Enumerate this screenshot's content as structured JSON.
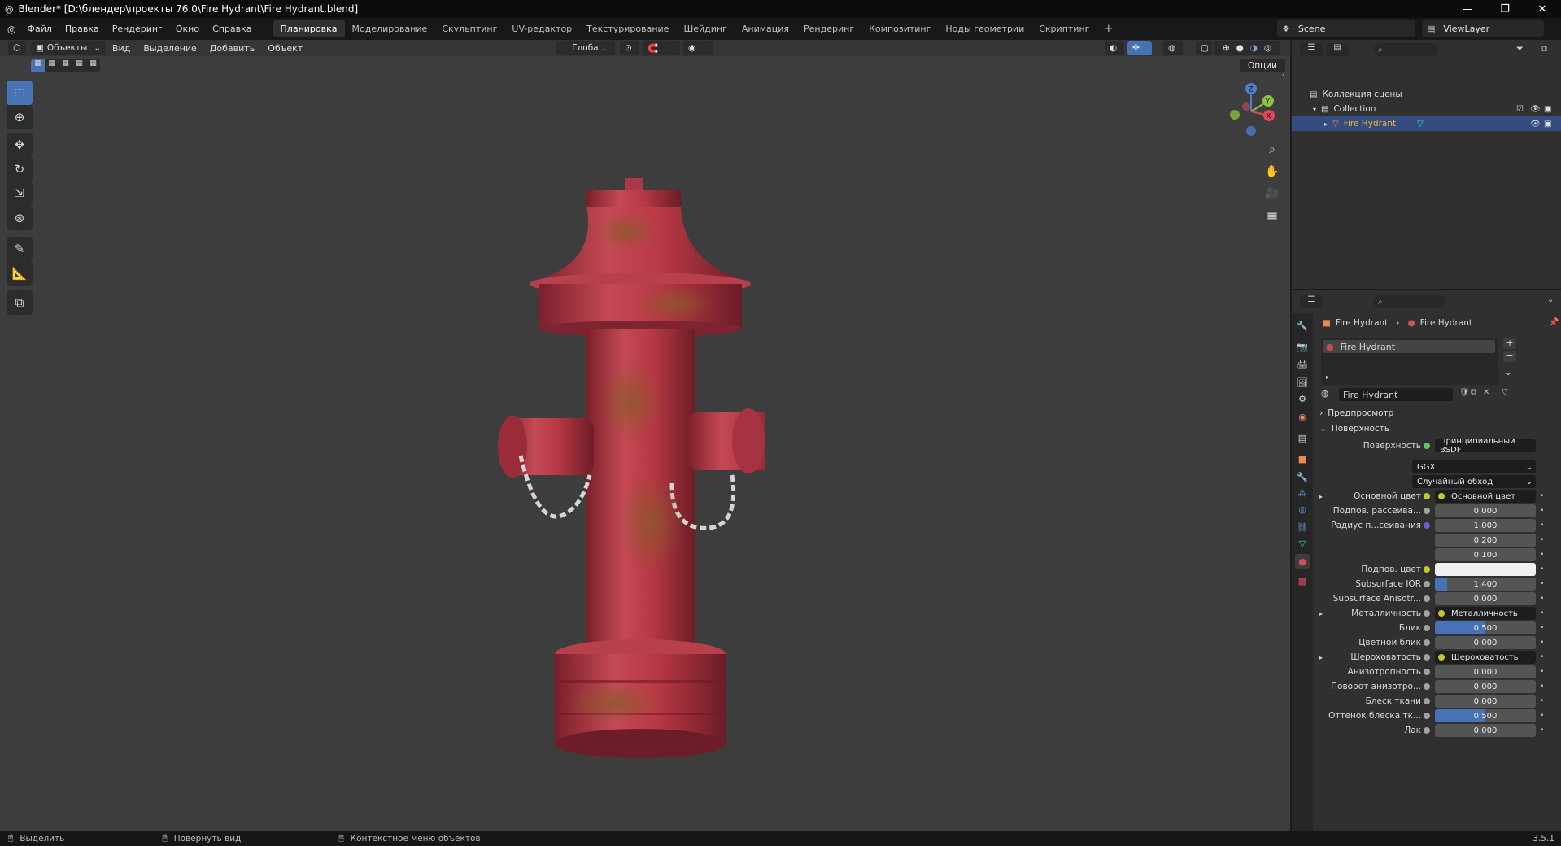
{
  "window": {
    "title": "Blender* [D:\\блендер\\проекты 76.0\\Fire Hydrant\\Fire Hydrant.blend]",
    "minimize": "—",
    "maximize": "❐",
    "close": "✕"
  },
  "menu": {
    "items": [
      "Файл",
      "Правка",
      "Рендеринг",
      "Окно",
      "Справка"
    ],
    "workspaces": [
      "Планировка",
      "Моделирование",
      "Скульптинг",
      "UV-редактор",
      "Текстурирование",
      "Шейдинг",
      "Анимация",
      "Рендеринг",
      "Композитинг",
      "Ноды геометрии",
      "Скриптинг"
    ],
    "add_workspace": "+",
    "scene": "Scene",
    "view_layer": "ViewLayer"
  },
  "viewport": {
    "mode": "Объекты",
    "menu": [
      "Вид",
      "Выделение",
      "Добавить",
      "Объект"
    ],
    "orientation": "Глоба...",
    "options": "Опции",
    "gizmo_axes": {
      "x": "X",
      "y": "Y",
      "z": "Z"
    },
    "colors": {
      "background": "#3d3d3d",
      "hydrant": "#b23a45",
      "active_tool": "#4772b3"
    }
  },
  "outliner": {
    "search_placeholder": "",
    "scene_collection": "Коллекция сцены",
    "collection": "Collection",
    "object": "Fire Hydrant"
  },
  "properties": {
    "breadcrumb_object": "Fire Hydrant",
    "breadcrumb_material": "Fire Hydrant",
    "slot": "Fire Hydrant",
    "material_name": "Fire Hydrant",
    "sections": {
      "preview": "Предпросмотр",
      "surface": "Поверхность"
    },
    "surface_label": "Поверхность",
    "surface_shader": "Принципиальный BSDF",
    "distribution": "GGX",
    "subsurface_method": "Случайный обход",
    "rows": [
      {
        "label": "Основной цвет",
        "value": "Основной цвет",
        "kind": "link",
        "bullet": "y",
        "expand": "▸"
      },
      {
        "label": "Подпов. рассеива...",
        "value": "0.000",
        "kind": "num",
        "bullet": "gr",
        "fill": 0
      },
      {
        "label": "Радиус п...сеивания",
        "value": "1.000",
        "kind": "num",
        "bullet": "b",
        "fill": 0
      },
      {
        "label": "",
        "value": "0.200",
        "kind": "num",
        "bullet": "",
        "fill": 0
      },
      {
        "label": "",
        "value": "0.100",
        "kind": "num",
        "bullet": "",
        "fill": 0
      },
      {
        "label": "Подпов. цвет",
        "value": "",
        "kind": "color",
        "bullet": "y",
        "fill": 0
      },
      {
        "label": "Subsurface IOR",
        "value": "1.400",
        "kind": "num",
        "bullet": "gr",
        "fill": 0.12
      },
      {
        "label": "Subsurface Anisotr...",
        "value": "0.000",
        "kind": "num",
        "bullet": "gr",
        "fill": 0
      },
      {
        "label": "Металличность",
        "value": "Металличность",
        "kind": "link",
        "bullet": "gr",
        "expand": "▸"
      },
      {
        "label": "Блик",
        "value": "0.500",
        "kind": "num",
        "bullet": "gr",
        "fill": 0.5
      },
      {
        "label": "Цветной блик",
        "value": "0.000",
        "kind": "num",
        "bullet": "gr",
        "fill": 0
      },
      {
        "label": "Шероховатость",
        "value": "Шероховатость",
        "kind": "link",
        "bullet": "gr",
        "expand": "▸"
      },
      {
        "label": "Анизотропность",
        "value": "0.000",
        "kind": "num",
        "bullet": "gr",
        "fill": 0
      },
      {
        "label": "Поворот анизотро...",
        "value": "0.000",
        "kind": "num",
        "bullet": "gr",
        "fill": 0
      },
      {
        "label": "Блеск ткани",
        "value": "0.000",
        "kind": "num",
        "bullet": "gr",
        "fill": 0
      },
      {
        "label": "Оттенок блеска тк...",
        "value": "0.500",
        "kind": "num",
        "bullet": "gr",
        "fill": 0.5
      },
      {
        "label": "Лак",
        "value": "0.000",
        "kind": "num",
        "bullet": "gr",
        "fill": 0
      }
    ]
  },
  "status": {
    "select": "Выделить",
    "rotate": "Повернуть вид",
    "context": "Контекстное меню объектов",
    "version": "3.5.1"
  }
}
